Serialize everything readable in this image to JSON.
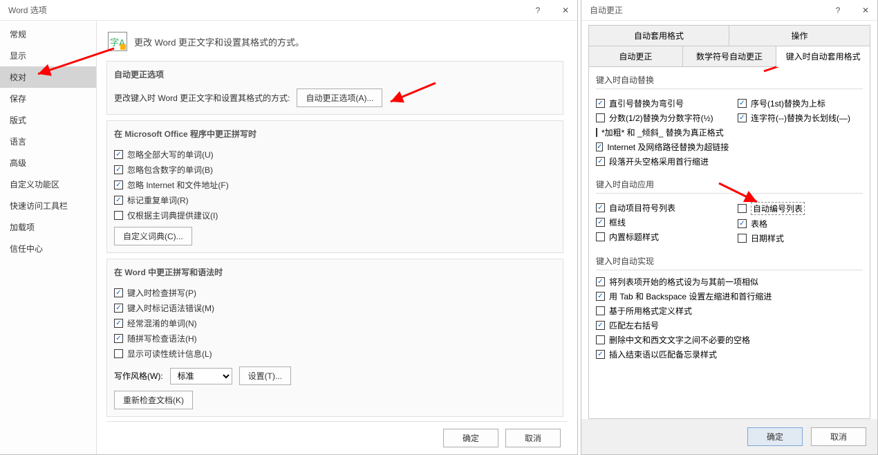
{
  "leftDialog": {
    "title": "Word 选项",
    "help_glyph": "?",
    "close_glyph": "✕",
    "sidebar": {
      "items": [
        {
          "label": "常规"
        },
        {
          "label": "显示"
        },
        {
          "label": "校对"
        },
        {
          "label": "保存"
        },
        {
          "label": "版式"
        },
        {
          "label": "语言"
        },
        {
          "label": "高级"
        },
        {
          "label": "自定义功能区"
        },
        {
          "label": "快速访问工具栏"
        },
        {
          "label": "加载项"
        },
        {
          "label": "信任中心"
        }
      ],
      "selected_index": 2
    },
    "header_icon_text": "字A",
    "header_text": "更改 Word 更正文字和设置其格式的方式。",
    "section_autocorrect": {
      "title": "自动更正选项",
      "desc": "更改键入时 Word 更正文字和设置其格式的方式:",
      "button": "自动更正选项(A)..."
    },
    "section_spell": {
      "title": "在 Microsoft Office 程序中更正拼写时",
      "checks": [
        {
          "label": "忽略全部大写的单词(U)",
          "checked": true
        },
        {
          "label": "忽略包含数字的单词(B)",
          "checked": true
        },
        {
          "label": "忽略 Internet 和文件地址(F)",
          "checked": true
        },
        {
          "label": "标记重复单词(R)",
          "checked": true
        },
        {
          "label": "仅根据主词典提供建议(I)",
          "checked": false
        }
      ],
      "dict_button": "自定义词典(C)..."
    },
    "section_grammar": {
      "title": "在 Word 中更正拼写和语法时",
      "checks": [
        {
          "label": "键入时检查拼写(P)",
          "checked": true
        },
        {
          "label": "键入时标记语法错误(M)",
          "checked": true
        },
        {
          "label": "经常混淆的单词(N)",
          "checked": true
        },
        {
          "label": "随拼写检查语法(H)",
          "checked": true
        },
        {
          "label": "显示可读性统计信息(L)",
          "checked": false
        }
      ],
      "style_label": "写作风格(W):",
      "style_value": "标准",
      "settings_button": "设置(T)...",
      "recheck_button": "重新检查文档(K)"
    },
    "footer": {
      "ok": "确定",
      "cancel": "取消"
    }
  },
  "rightDialog": {
    "title": "自动更正",
    "help_glyph": "?",
    "close_glyph": "✕",
    "tabs_top": [
      {
        "label": "自动套用格式"
      },
      {
        "label": "操作"
      }
    ],
    "tabs_bottom": [
      {
        "label": "自动更正"
      },
      {
        "label": "数学符号自动更正"
      },
      {
        "label": "键入时自动套用格式"
      }
    ],
    "active_tab": "键入时自动套用格式",
    "group_replace": {
      "title": "键入时自动替换",
      "left": [
        {
          "label": "直引号替换为弯引号",
          "checked": true
        },
        {
          "label": "分数(1/2)替换为分数字符(½)",
          "checked": false
        },
        {
          "label": "*加粗* 和 _倾斜_ 替换为真正格式",
          "checked": false
        },
        {
          "label": "Internet 及网络路径替换为超链接",
          "checked": true
        },
        {
          "label": "段落开头空格采用首行缩进",
          "checked": true
        }
      ],
      "right": [
        {
          "label": "序号(1st)替换为上标",
          "checked": true
        },
        {
          "label": "连字符(--)替换为长划线(—)",
          "checked": true
        }
      ]
    },
    "group_apply": {
      "title": "键入时自动应用",
      "left": [
        {
          "label": "自动项目符号列表",
          "checked": true
        },
        {
          "label": "框线",
          "checked": true
        },
        {
          "label": "内置标题样式",
          "checked": false
        }
      ],
      "right": [
        {
          "label": "自动编号列表",
          "checked": false,
          "boxed": true
        },
        {
          "label": "表格",
          "checked": true
        },
        {
          "label": "日期样式",
          "checked": false
        }
      ]
    },
    "group_realize": {
      "title": "键入时自动实现",
      "items": [
        {
          "label": "将列表项开始的格式设为与其前一项相似",
          "checked": true
        },
        {
          "label": "用 Tab 和 Backspace 设置左缩进和首行缩进",
          "checked": true
        },
        {
          "label": "基于所用格式定义样式",
          "checked": false
        },
        {
          "label": "匹配左右括号",
          "checked": true
        },
        {
          "label": "删除中文和西文文字之间不必要的空格",
          "checked": false
        },
        {
          "label": "插入结束语以匹配备忘录样式",
          "checked": true
        }
      ]
    },
    "footer": {
      "ok": "确定",
      "cancel": "取消"
    }
  }
}
